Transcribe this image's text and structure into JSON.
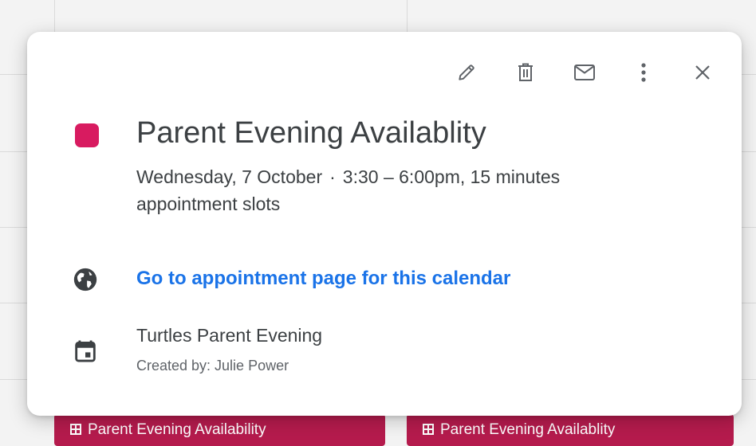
{
  "event": {
    "title": "Parent Evening Availablity",
    "date": "Wednesday, 7 October",
    "separator": "·",
    "time_line": "3:30 – 6:00pm, 15 minutes",
    "slots_line": "appointment slots",
    "color": "#d81b60"
  },
  "toolbar": {
    "edit_icon": "pencil-icon",
    "delete_icon": "trash-icon",
    "email_icon": "mail-icon",
    "more_icon": "more-vert-icon",
    "close_icon": "close-icon"
  },
  "appointment_link": "Go to appointment page for this calendar",
  "calendar": {
    "name": "Turtles Parent Evening",
    "created_by": "Created by: Julie Power"
  },
  "background_events": [
    {
      "label": "Parent Evening Availability"
    },
    {
      "label": "Parent Evening Availablity"
    }
  ]
}
